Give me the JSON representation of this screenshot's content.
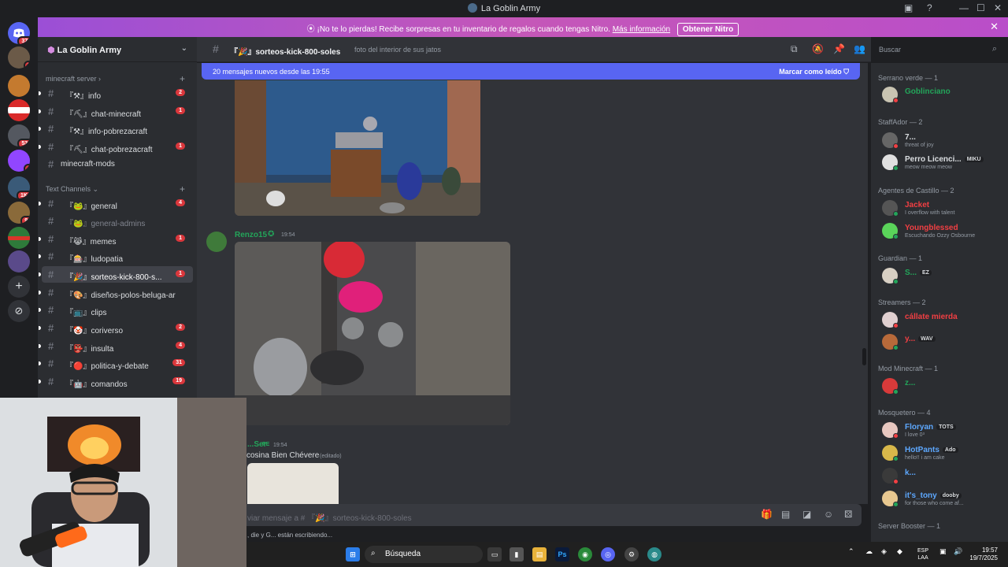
{
  "window": {
    "title": "La Goblin Army"
  },
  "colors": {
    "accent": "#5865f2",
    "badge_red": "#da373c",
    "online": "#23a55a",
    "dnd": "#f23f43"
  },
  "rail": {
    "badges": [
      "372",
      "7",
      "",
      "",
      "530",
      "6",
      "1K+",
      "90",
      "",
      ""
    ]
  },
  "nitro": {
    "message": "¡No te lo pierdas! Recibe sorpresas en tu inventario de regalos cuando tengas Nitro.",
    "link": "Más información",
    "button": "Obtener Nitro"
  },
  "server": {
    "name": "La Goblin Army"
  },
  "sidebar": {
    "category1": "minecraft server",
    "channels1": [
      {
        "name": "『⚒』info",
        "badge": "2"
      },
      {
        "name": "『⛏』chat-minecraft",
        "badge": "1"
      },
      {
        "name": "『⚒』info-pobrezacraft",
        "badge": ""
      },
      {
        "name": "『⛏』chat-pobrezacraft",
        "badge": "1"
      },
      {
        "name": "minecraft-mods",
        "badge": ""
      }
    ],
    "category2": "Text Channels",
    "channels2": [
      {
        "name": "『🐸』general",
        "badge": "4"
      },
      {
        "name": "『🐸』general-admins",
        "badge": ""
      },
      {
        "name": "『😹』memes",
        "badge": "1"
      },
      {
        "name": "『🎰』ludopatia",
        "badge": ""
      },
      {
        "name": "『🎉』sorteos-kick-800-s...",
        "badge": "1"
      },
      {
        "name": "『🎨』diseños-polos-beluga-ar...",
        "badge": ""
      },
      {
        "name": "『📺』clips",
        "badge": ""
      },
      {
        "name": "『🤡』coriverso",
        "badge": "2"
      },
      {
        "name": "『👺』insulta",
        "badge": "4"
      },
      {
        "name": "『🔴』politica-y-debate",
        "badge": "31"
      },
      {
        "name": "『🤖』comandos",
        "badge": "19"
      }
    ]
  },
  "header": {
    "channel": "『🎉』sorteos-kick-800-soles",
    "topic": "foto del interior de sus jatos",
    "search_placeholder": "Buscar"
  },
  "chat": {
    "new_messages": "20 mensajes nuevos desde las 19:55",
    "mark_read": "Marcar como leído",
    "msg1": {
      "author": "Renzo15",
      "time": "19:54"
    },
    "msg2": {
      "author": "...Ser",
      "flag": "PE",
      "time": "19:54",
      "text": "cosina Bien Chévere",
      "edited": "(editado)"
    }
  },
  "composer": {
    "placeholder": "viar mensaje a # 『🎉』sorteos-kick-800-soles",
    "typing": ", die y G... están escribiendo..."
  },
  "members": {
    "groups": [
      {
        "role": "Serrano verde — 1",
        "members": [
          {
            "name": "Goblinciano",
            "sub": "",
            "tag": "",
            "color": "#23a55a",
            "status": "dnd"
          }
        ]
      },
      {
        "role": "StaffAdor — 2",
        "members": [
          {
            "name": "7...",
            "sub": "threat of joy",
            "tag": "",
            "color": "#dbdee1",
            "status": "dnd"
          },
          {
            "name": "Perro Licenci...",
            "sub": "meow meow meow",
            "tag": "MIKU",
            "color": "#dbdee1",
            "status": "online"
          }
        ]
      },
      {
        "role": "Agentes de Castillo — 2",
        "members": [
          {
            "name": "Jacket",
            "sub": "I overflow with talent",
            "tag": "",
            "color": "#f23f43",
            "status": "online"
          },
          {
            "name": "Youngblessed",
            "sub": "Escuchando Ozzy Osbourne",
            "tag": "",
            "color": "#f23f43",
            "status": "online"
          }
        ]
      },
      {
        "role": "Guardian — 1",
        "members": [
          {
            "name": "S...",
            "sub": "",
            "tag": "EZ",
            "color": "#23a55a",
            "status": "online"
          }
        ]
      },
      {
        "role": "Streamers — 2",
        "members": [
          {
            "name": "cállate mierda",
            "sub": "",
            "tag": "",
            "color": "#f23f43",
            "status": "dnd"
          },
          {
            "name": "y...",
            "sub": "",
            "tag": "WAV",
            "color": "#f23f43",
            "status": "online"
          }
        ]
      },
      {
        "role": "Mod Minecraft — 1",
        "members": [
          {
            "name": "z...",
            "sub": "",
            "tag": "",
            "color": "#23a55a",
            "status": "online"
          }
        ]
      },
      {
        "role": "Mosquetero — 4",
        "members": [
          {
            "name": "Floryan",
            "sub": "I love 0³",
            "tag": "TOTS",
            "color": "#5da8ff",
            "status": "dnd"
          },
          {
            "name": "HotPants",
            "sub": "hello!! i am cake",
            "tag": "Ado",
            "color": "#5da8ff",
            "status": "online"
          },
          {
            "name": "k...",
            "sub": "",
            "tag": "",
            "color": "#5da8ff",
            "status": "dnd"
          },
          {
            "name": "it's_tony",
            "sub": "for those who come af...",
            "tag": "dooby",
            "color": "#5da8ff",
            "status": "online"
          }
        ]
      },
      {
        "role": "Server Booster — 1",
        "members": []
      }
    ]
  },
  "taskbar": {
    "search": "Búsqueda",
    "lang1": "ESP",
    "lang2": "LAA",
    "time": "19:57",
    "date": "19/7/2025"
  }
}
